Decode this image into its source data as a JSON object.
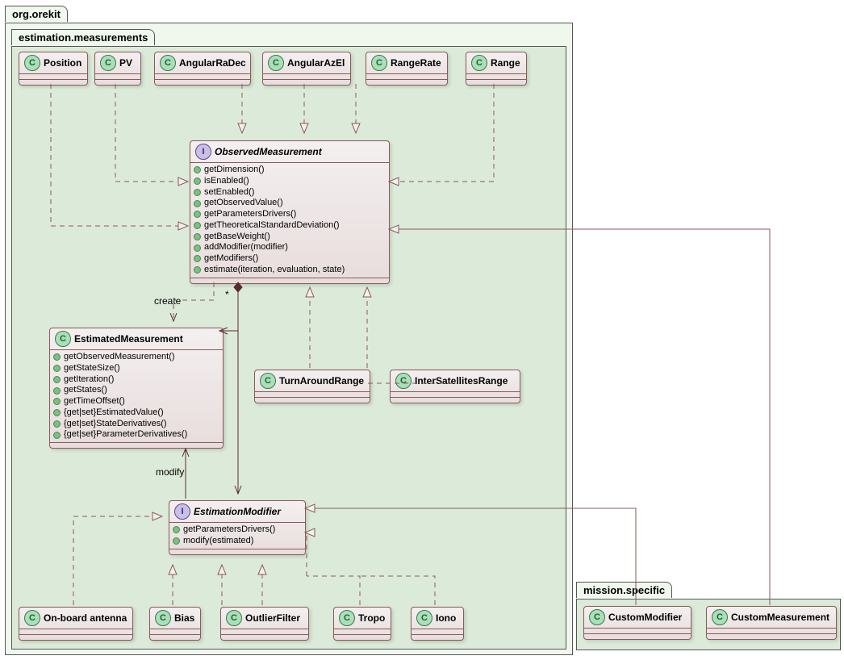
{
  "packages": {
    "outer": "org.orekit",
    "inner": "estimation.measurements",
    "mission": "mission.specific"
  },
  "classes": {
    "position": {
      "name": "Position",
      "badge": "C"
    },
    "pv": {
      "name": "PV",
      "badge": "C"
    },
    "angularRaDec": {
      "name": "AngularRaDec",
      "badge": "C"
    },
    "angularAzEl": {
      "name": "AngularAzEl",
      "badge": "C"
    },
    "rangeRate": {
      "name": "RangeRate",
      "badge": "C"
    },
    "range": {
      "name": "Range",
      "badge": "C"
    },
    "observedMeasurement": {
      "name": "ObservedMeasurement",
      "badge": "I",
      "methods": [
        "getDimension()",
        "isEnabled()",
        "setEnabled()",
        "getObservedValue()",
        "getParametersDrivers()",
        "getTheoreticalStandardDeviation()",
        "getBaseWeight()",
        "addModifier(modifier)",
        "getModifiers()",
        "estimate(iteration, evaluation, state)"
      ]
    },
    "estimatedMeasurement": {
      "name": "EstimatedMeasurement",
      "badge": "C",
      "methods": [
        "getObservedMeasurement()",
        "getStateSize()",
        "getIteration()",
        "getStates()",
        "getTimeOffset()",
        "{get|set}EstimatedValue()",
        "{get|set}StateDerivatives()",
        "{get|set}ParameterDerivatives()"
      ]
    },
    "turnAroundRange": {
      "name": "TurnAroundRange",
      "badge": "C"
    },
    "interSatellitesRange": {
      "name": "InterSatellitesRange",
      "badge": "C"
    },
    "estimationModifier": {
      "name": "EstimationModifier",
      "badge": "I",
      "methods": [
        "getParametersDrivers()",
        "modify(estimated)"
      ]
    },
    "onBoardAntenna": {
      "name": "On-board antenna",
      "badge": "C"
    },
    "bias": {
      "name": "Bias",
      "badge": "C"
    },
    "outlierFilter": {
      "name": "OutlierFilter",
      "badge": "C"
    },
    "tropo": {
      "name": "Tropo",
      "badge": "C"
    },
    "iono": {
      "name": "Iono",
      "badge": "C"
    },
    "customModifier": {
      "name": "CustomModifier",
      "badge": "C"
    },
    "customMeasurement": {
      "name": "CustomMeasurement",
      "badge": "C"
    }
  },
  "labels": {
    "create": "create",
    "createMult": "*",
    "modify": "modify"
  }
}
